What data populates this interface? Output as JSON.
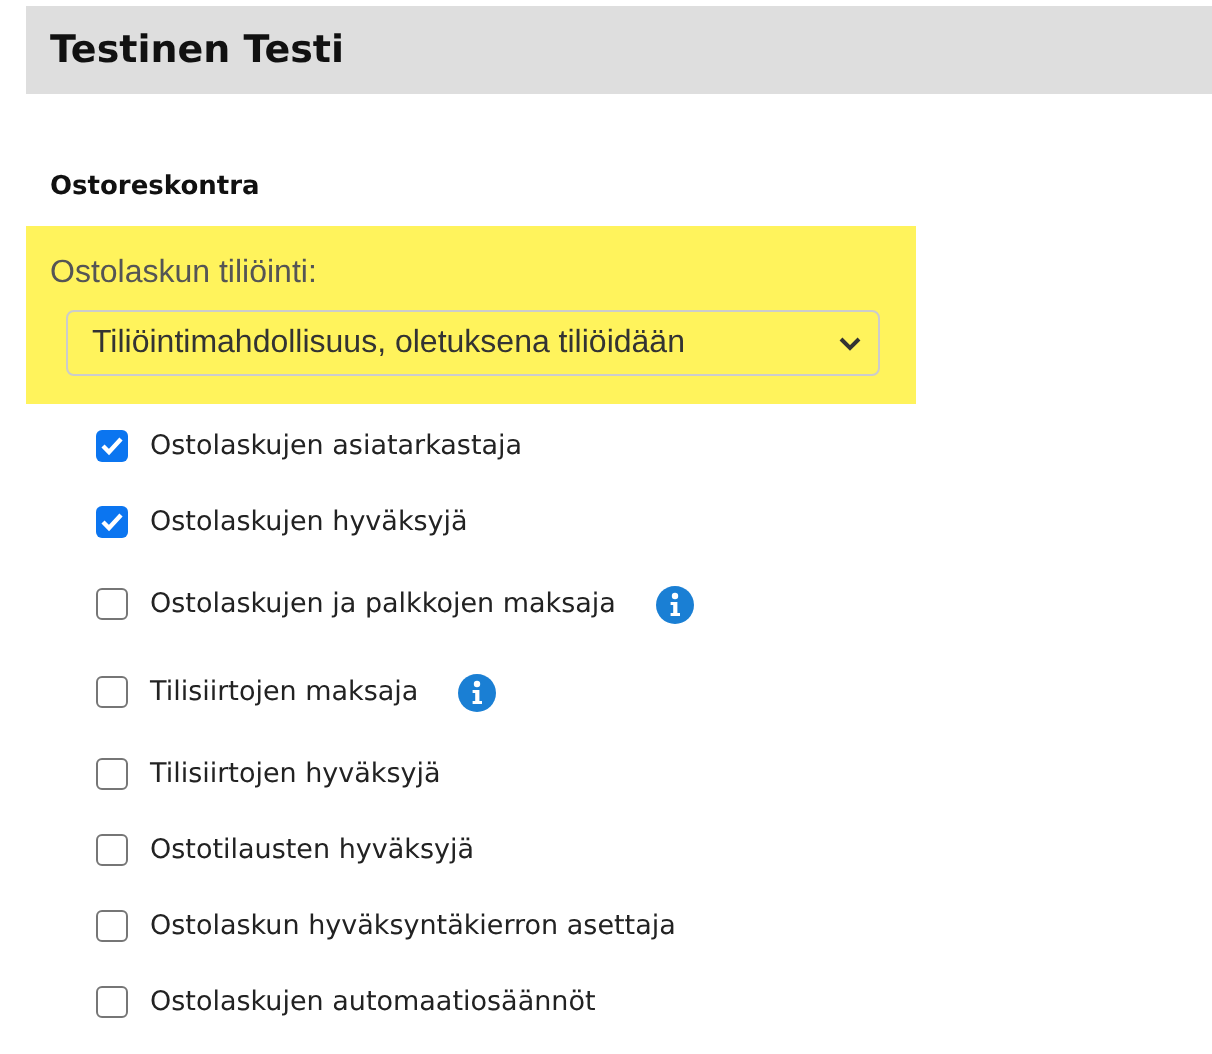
{
  "header": {
    "title": "Testinen Testi"
  },
  "section": {
    "title": "Ostoreskontra"
  },
  "select_field": {
    "label": "Ostolaskun tiliöinti:",
    "value": "Tiliöintimahdollisuus, oletuksena tiliöidään",
    "highlighted": true
  },
  "permissions": [
    {
      "label": "Ostolaskujen asiatarkastaja",
      "checked": true,
      "info": false
    },
    {
      "label": "Ostolaskujen hyväksyjä",
      "checked": true,
      "info": false
    },
    {
      "label": "Ostolaskujen ja palkkojen maksaja",
      "checked": false,
      "info": true
    },
    {
      "label": "Tilisiirtojen maksaja",
      "checked": false,
      "info": true
    },
    {
      "label": "Tilisiirtojen hyväksyjä",
      "checked": false,
      "info": false
    },
    {
      "label": "Ostotilausten hyväksyjä",
      "checked": false,
      "info": false
    },
    {
      "label": "Ostolaskun hyväksyntäkierron asettaja",
      "checked": false,
      "info": false
    },
    {
      "label": "Ostolaskujen automaatiosäännöt",
      "checked": false,
      "info": false
    }
  ]
}
